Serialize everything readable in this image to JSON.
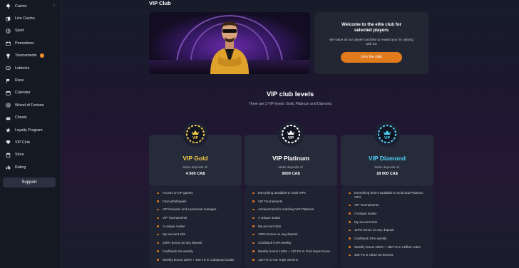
{
  "sidebar": {
    "items": [
      {
        "label": "Casino",
        "icon": "spade-icon",
        "chevron": "›"
      },
      {
        "label": "Live Casino",
        "icon": "cards-icon"
      },
      {
        "label": "Sport",
        "icon": "ball-icon"
      },
      {
        "label": "Promotions",
        "icon": "gift-icon"
      },
      {
        "label": "Tournaments",
        "icon": "trophy-icon",
        "badge": "!"
      },
      {
        "label": "Lotteries",
        "icon": "ticket-icon"
      },
      {
        "label": "Race",
        "icon": "flag-icon"
      },
      {
        "label": "Calendar",
        "icon": "calendar-icon"
      },
      {
        "label": "Wheel of Fortune",
        "icon": "wheel-icon"
      },
      {
        "label": "Chests",
        "icon": "chest-icon"
      },
      {
        "label": "Loyalty Program",
        "icon": "star-icon"
      },
      {
        "label": "VIP Club",
        "icon": "diamond-icon"
      },
      {
        "label": "Store",
        "icon": "store-icon"
      },
      {
        "label": "Rating",
        "icon": "rating-icon"
      }
    ],
    "support_label": "Support"
  },
  "page": {
    "title": "VIP Club"
  },
  "welcome": {
    "title_line1": "Welcome to the elite club for",
    "title_line2": "selected players",
    "text": "We value all our players and like to reward you for playing with us!",
    "button_label": "Join the club"
  },
  "levels": {
    "title": "VIP club levels",
    "subtitle": "There are 3 VIP levels: Gold, Platinum and Diamond",
    "cards": [
      {
        "name": "VIP Gold",
        "color": "#f1c94a",
        "chip_color": "#f1c94a",
        "deposit_label": "Make deposits of:",
        "deposit_value": "4 500 CA$",
        "features": [
          "Access to VIP games",
          "Fast withdrawals",
          "VIP bonuses and a personal manager",
          "VIP Tournaments",
          "A unique Avatar",
          "My account skin",
          "100% bonus on any deposit",
          "Cashback 9% weekly",
          "Weekly bonus 125% + 100 FS in Collapsed Castle"
        ]
      },
      {
        "name": "VIP Platinum",
        "color": "#ffffff",
        "chip_color": "#ffffff",
        "deposit_label": "Make deposits of:",
        "deposit_value": "9000 CA$",
        "features": [
          "Everything available to Gold VIPs",
          "VIP Tournaments",
          "Achievement for reaching VIP Platinum",
          "A unique avatar",
          "My account skin",
          "100% bonus on any deposit",
          "Cashback 9.5% weekly",
          "Weekly bonus 125% + 120 FS in Fruit Super Nova",
          "120 FS in Hot Triple Sevens"
        ]
      },
      {
        "name": "VIP Diamond",
        "color": "#4fd0f5",
        "chip_color": "#4fd0f5",
        "deposit_label": "Make deposits of:",
        "deposit_value": "18 000 CA$",
        "features": [
          "Everything that is available to Gold and Platinum VIPs",
          "VIP Tournaments",
          "A unique avatar",
          "My account skin",
          "110% bonus on any deposit",
          "Cashback 10% weekly",
          "Weekly bonus 150% + 150 FS in Hellbor Joker",
          "200 FS in Ultra Hot Sevens"
        ]
      }
    ],
    "chip_label": "VIP"
  },
  "colors": {
    "accent": "#e07a1c",
    "background": "#141821"
  }
}
